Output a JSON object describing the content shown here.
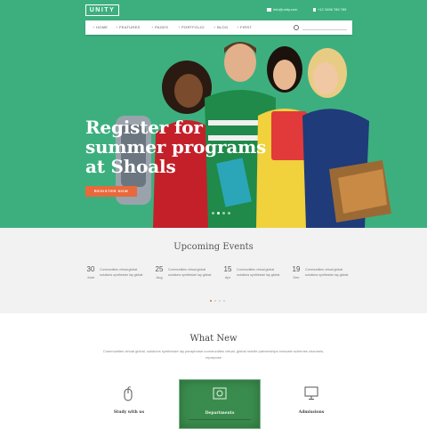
{
  "header": {
    "logo": "UNITY",
    "contact_email": "info@unity.com",
    "contact_phone": "+12 3456 789 789"
  },
  "nav": {
    "items": [
      "HOME",
      "FEATURES",
      "PAGES",
      "PORTFOLIO",
      "BLOG",
      "FIRST"
    ]
  },
  "hero": {
    "title_line1": "Register for",
    "title_line2": "summer programs",
    "title_line3": "at Shoals",
    "cta_label": "REGISTER NOW"
  },
  "events": {
    "title": "Upcoming Events",
    "items": [
      {
        "day": "30",
        "month": "June",
        "text": "Communities virtual global solutions synthesize lay global"
      },
      {
        "day": "25",
        "month": "Aug",
        "text": "Communities virtual global solutions synthesize lay global"
      },
      {
        "day": "15",
        "month": "Apr",
        "text": "Communities virtual global solutions synthesize lay global"
      },
      {
        "day": "19",
        "month": "Dec",
        "text": "Communities virtual global solutions synthesize lay global"
      }
    ]
  },
  "what_new": {
    "title": "What New",
    "description": "Communities virtual global, solutions synthesize lay paraphrase communities virtual, global mobile partnerships innovate schemes channels, repurpose",
    "features": [
      {
        "label": "Study with us",
        "icon": "mouse-icon"
      },
      {
        "label": "Departments",
        "icon": "photo-icon"
      },
      {
        "label": "Admissions",
        "icon": "monitor-icon"
      }
    ]
  },
  "colors": {
    "brand_green": "#3daf7f",
    "accent_orange": "#e8693b",
    "chalkboard_green": "#3a8c4e"
  }
}
